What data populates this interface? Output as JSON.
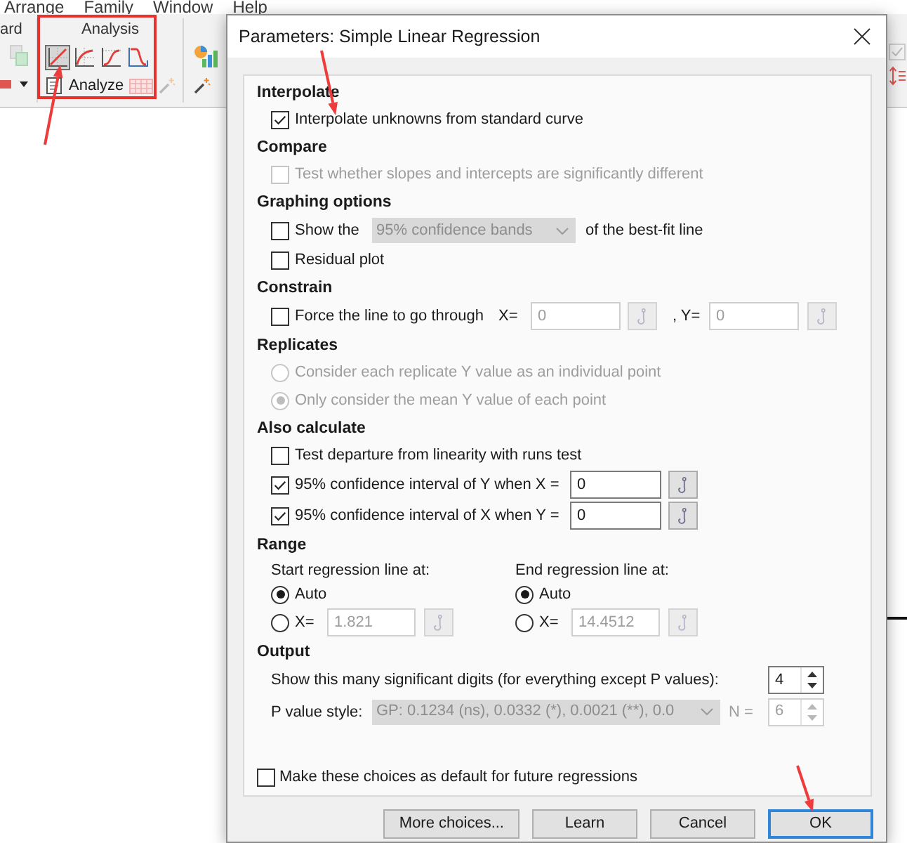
{
  "menu_bar": [
    "Arrange",
    "Family",
    "Window",
    "Help"
  ],
  "ribbon": {
    "clipboard_label": "ard",
    "analysis": {
      "label": "Analysis",
      "tools": [
        {
          "kind": "line",
          "selected": true
        },
        {
          "kind": "curve",
          "selected": false
        },
        {
          "kind": "sigmoid",
          "selected": false
        },
        {
          "kind": "decay",
          "selected": false
        }
      ],
      "analyze_button": "Analyze"
    }
  },
  "dialog": {
    "title": "Parameters: Simple Linear Regression",
    "sections": [
      {
        "heading": "Interpolate",
        "items": [
          {
            "kind": "checkbox",
            "label": "Interpolate unknowns from standard curve",
            "checked": true,
            "disabled": false
          }
        ]
      },
      {
        "heading": "Compare",
        "items": [
          {
            "kind": "checkbox",
            "label": "Test whether slopes and intercepts are significantly different",
            "checked": false,
            "disabled": true
          }
        ]
      },
      {
        "heading": "Graphing options",
        "items": [
          {
            "kind": "checkbox_select",
            "label": "Show the",
            "checked": false,
            "select": "95% confidence bands",
            "select_disabled": true,
            "suffix": "of the best-fit line"
          },
          {
            "kind": "checkbox",
            "label": "Residual plot",
            "checked": false,
            "disabled": false
          }
        ]
      },
      {
        "heading": "Constrain",
        "items": [
          {
            "kind": "checkbox_point",
            "label": "Force the line to go through",
            "checked": false,
            "fields": [
              {
                "label": "X=",
                "value": "0",
                "disabled": true
              },
              {
                "label": ", Y=",
                "value": "0",
                "disabled": true
              }
            ]
          }
        ]
      },
      {
        "heading": "Replicates",
        "items": [
          {
            "kind": "radio",
            "label": "Consider each replicate Y value as an individual point",
            "selected": false,
            "disabled": true
          },
          {
            "kind": "radio",
            "label": "Only consider the mean Y value of each point",
            "selected": true,
            "disabled": true
          }
        ]
      },
      {
        "heading": "Also calculate",
        "items": [
          {
            "kind": "checkbox",
            "label": "Test departure from linearity with runs test",
            "checked": false,
            "disabled": false
          },
          {
            "kind": "checkbox_input",
            "label": "95% confidence interval of Y when X =",
            "checked": true,
            "value": "0",
            "disabled": false
          },
          {
            "kind": "checkbox_input",
            "label": "95% confidence interval of X when Y =",
            "checked": true,
            "value": "0",
            "disabled": false
          }
        ]
      },
      {
        "heading": "Range",
        "items": [
          {
            "kind": "columns",
            "columns": [
              {
                "label": "Start regression line at:",
                "options": [
                  {
                    "kind": "radio",
                    "label": "Auto",
                    "selected": true
                  },
                  {
                    "kind": "radio_input",
                    "label": "X=",
                    "selected": false,
                    "value": "1.821",
                    "disabled": true
                  }
                ]
              },
              {
                "label": "End regression line at:",
                "options": [
                  {
                    "kind": "radio",
                    "label": "Auto",
                    "selected": true
                  },
                  {
                    "kind": "radio_input",
                    "label": "X=",
                    "selected": false,
                    "value": "14.4512",
                    "disabled": true
                  }
                ]
              }
            ]
          }
        ]
      },
      {
        "heading": "Output",
        "items": [
          {
            "kind": "spin",
            "label": "Show this many significant digits (for everything except P values):",
            "value": "4",
            "disabled": false
          },
          {
            "kind": "select_spin",
            "label": "P value style:",
            "select": "GP: 0.1234 (ns), 0.0332 (*), 0.0021 (**), 0.0",
            "select_disabled": true,
            "n_label": "N =",
            "n_value": "6",
            "n_disabled": true
          }
        ]
      }
    ],
    "default_choice": {
      "label": "Make these choices as default for future regressions",
      "checked": false
    },
    "buttons": [
      {
        "label": "More choices...",
        "default": false
      },
      {
        "label": "Learn",
        "default": false
      },
      {
        "label": "Cancel",
        "default": false
      },
      {
        "label": "OK",
        "default": true
      }
    ]
  }
}
